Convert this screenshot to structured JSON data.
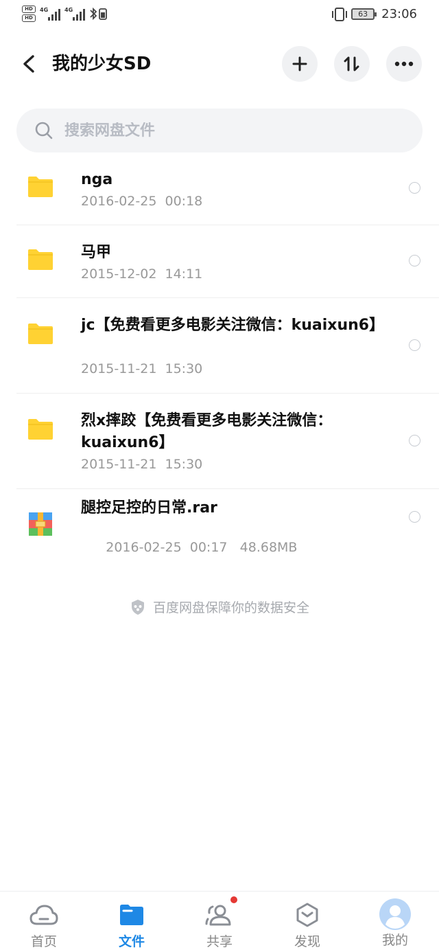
{
  "status_bar": {
    "network_left": "4G",
    "network_right": "4G",
    "battery": "63",
    "time": "23:06"
  },
  "header": {
    "title": "我的少女SD"
  },
  "search": {
    "placeholder": "搜索网盘文件"
  },
  "files": [
    {
      "type": "folder",
      "name": "nga",
      "date": "2016-02-25  00:18",
      "size": ""
    },
    {
      "type": "folder",
      "name": "马甲",
      "date": "2015-12-02  14:11",
      "size": ""
    },
    {
      "type": "folder",
      "name": "jc【免费看更多电影关注微信：kuaixun6】",
      "date": "2015-11-21  15:30",
      "size": ""
    },
    {
      "type": "folder",
      "name": "烈x摔跤【免费看更多电影关注微信：kuaixun6】",
      "date": "2015-11-21  15:30",
      "size": ""
    },
    {
      "type": "rar",
      "name": "腿控足控的日常.rar",
      "date": "2016-02-25  00:17",
      "size": "48.68MB"
    }
  ],
  "safety_note": "百度网盘保障你的数据安全",
  "tabs": [
    {
      "label": "首页",
      "icon": "cloud-icon",
      "active": false
    },
    {
      "label": "文件",
      "icon": "folder-icon",
      "active": true
    },
    {
      "label": "共享",
      "icon": "people-icon",
      "active": false
    },
    {
      "label": "发现",
      "icon": "discover-icon",
      "active": false
    },
    {
      "label": "我的",
      "icon": "avatar-icon",
      "active": false
    }
  ],
  "colors": {
    "accent": "#1e88e5",
    "folder": "#ffd233",
    "badge": "#e53935"
  }
}
